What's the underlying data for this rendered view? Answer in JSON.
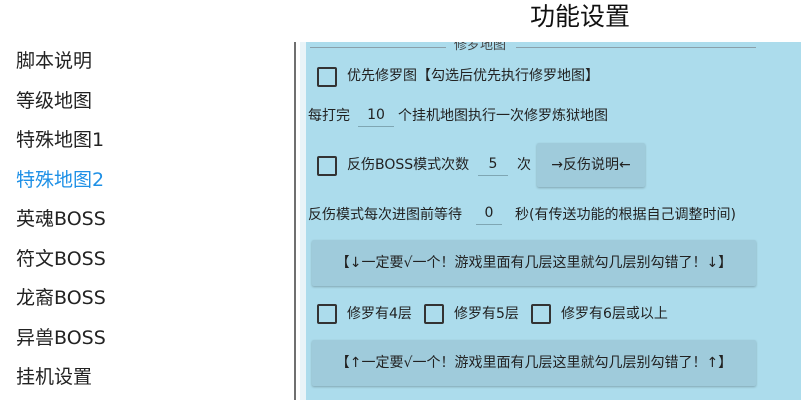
{
  "header": {
    "title": "功能设置"
  },
  "sidebar": {
    "items": [
      {
        "label": "脚本说明",
        "active": false
      },
      {
        "label": "等级地图",
        "active": false
      },
      {
        "label": "特殊地图1",
        "active": false
      },
      {
        "label": "特殊地图2",
        "active": true
      },
      {
        "label": "英魂BOSS",
        "active": false
      },
      {
        "label": "符文BOSS",
        "active": false
      },
      {
        "label": "龙裔BOSS",
        "active": false
      },
      {
        "label": "异兽BOSS",
        "active": false
      },
      {
        "label": "挂机设置",
        "active": false
      }
    ]
  },
  "panel": {
    "section_title": "修罗地图",
    "priority_checkbox_label": "优先修罗图【勾选后优先执行修罗地图】",
    "every_prefix": "每打完",
    "every_value": "10",
    "every_suffix": "个挂机地图执行一次修罗炼狱地图",
    "reflect_checkbox_label": "反伤BOSS模式次数",
    "reflect_value": "5",
    "reflect_unit": "次",
    "reflect_help_button": "→反伤说明←",
    "wait_prefix": "反伤模式每次进图前等待",
    "wait_value": "0",
    "wait_suffix": "秒(有传送功能的根据自己调整时间)",
    "notice_down": "【↓一定要√一个！游戏里面有几层这里就勾几层别勾错了！↓】",
    "floor_options": [
      "修罗有4层",
      "修罗有5层",
      "修罗有6层或以上"
    ],
    "notice_up": "【↑一定要√一个！游戏里面有几层这里就勾几层别勾错了！↑】"
  },
  "colors": {
    "accent": "#1e90e6",
    "panel_bg": "#acdcec",
    "button_bg": "#9fcbdb"
  }
}
